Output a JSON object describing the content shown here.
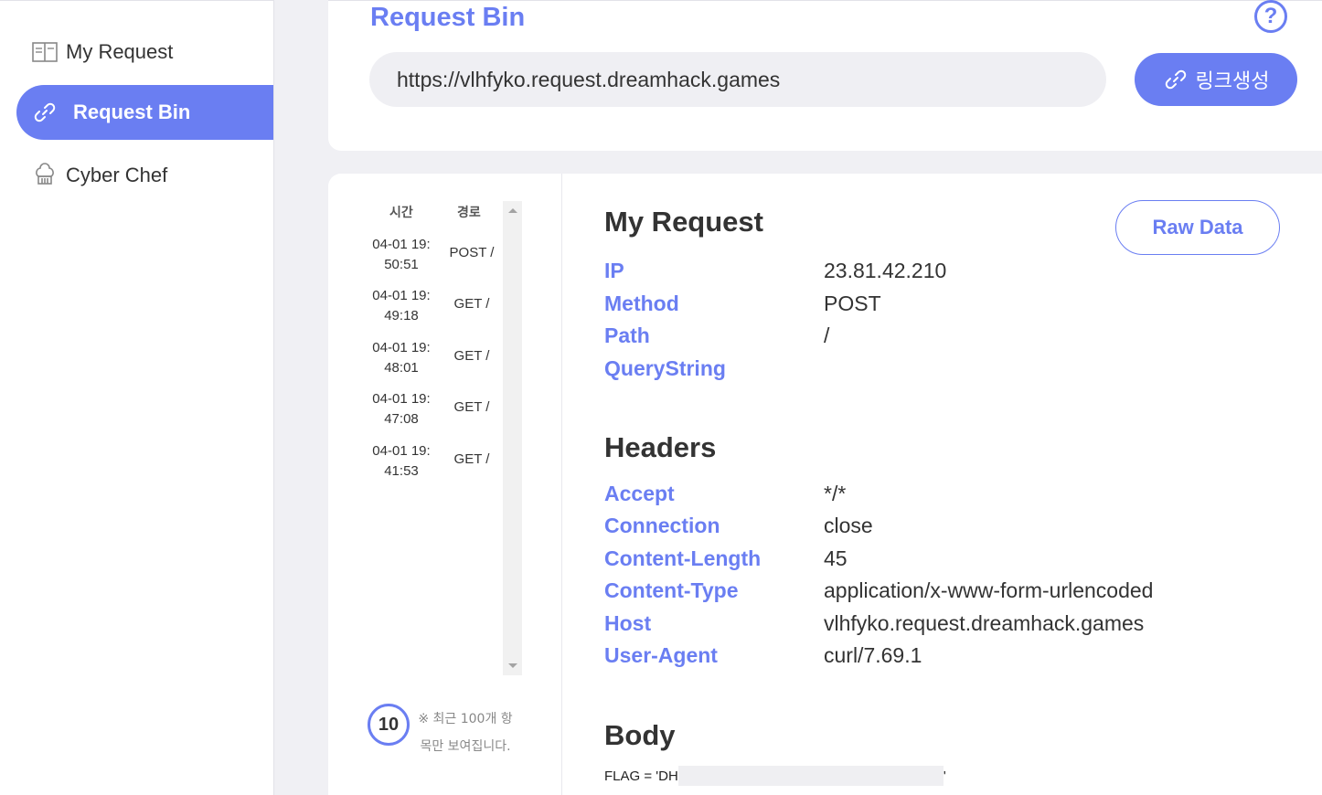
{
  "sidebar": {
    "items": [
      {
        "label": "My Request",
        "icon": "book-icon"
      },
      {
        "label": "Request Bin",
        "icon": "link-icon"
      },
      {
        "label": "Cyber Chef",
        "icon": "chef-hat-icon"
      }
    ]
  },
  "header": {
    "title": "Request Bin",
    "help": "?",
    "url": "https://vlhfyko.request.dreamhack.games",
    "link_button": "링크생성"
  },
  "list": {
    "col_time": "시간",
    "col_path": "경로",
    "rows": [
      {
        "time": "04-01 19:\n50:51",
        "path": "POST /"
      },
      {
        "time": "04-01 19:\n49:18",
        "path": "GET /"
      },
      {
        "time": "04-01 19:\n48:01",
        "path": "GET /"
      },
      {
        "time": "04-01 19:\n47:08",
        "path": "GET /"
      },
      {
        "time": "04-01 19:\n41:53",
        "path": "GET /"
      }
    ],
    "count": "10",
    "note": "※ 최근 100개 항목만 보여집니다."
  },
  "request": {
    "title": "My Request",
    "raw_button": "Raw Data",
    "fields": [
      {
        "key": "IP",
        "value": "23.81.42.210"
      },
      {
        "key": "Method",
        "value": "POST"
      },
      {
        "key": "Path",
        "value": "/"
      },
      {
        "key": "QueryString",
        "value": ""
      }
    ]
  },
  "headers": {
    "title": "Headers",
    "fields": [
      {
        "key": "Accept",
        "value": "*/*"
      },
      {
        "key": "Connection",
        "value": "close"
      },
      {
        "key": "Content-Length",
        "value": "45"
      },
      {
        "key": "Content-Type",
        "value": "application/x-www-form-urlencoded"
      },
      {
        "key": "Host",
        "value": "vlhfyko.request.dreamhack.games"
      },
      {
        "key": "User-Agent",
        "value": "curl/7.69.1"
      }
    ]
  },
  "body": {
    "title": "Body",
    "prefix": "FLAG = 'DH",
    "suffix": "'"
  },
  "colors": {
    "accent": "#6a7ef2",
    "background": "#f0f0f4"
  }
}
